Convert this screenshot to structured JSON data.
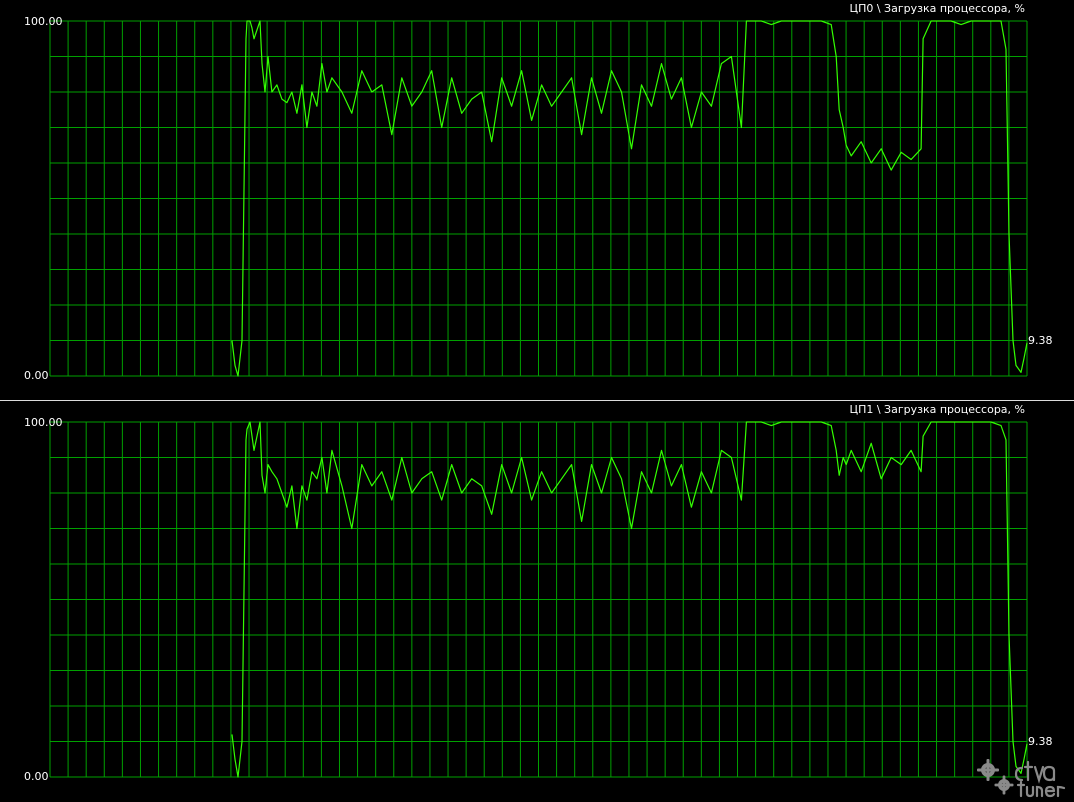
{
  "theme": {
    "background": "#000000",
    "grid_color": "#00a000",
    "line_color": "#33ff00",
    "text_color": "#ffffff",
    "divider_color": "#dcdcdc"
  },
  "chart_data": [
    {
      "type": "line",
      "title": "ЦП0 \\ Загрузка процессора, %",
      "ylim": [
        0,
        100
      ],
      "y_tick_labels": [
        "100.00",
        "0.00"
      ],
      "grid": true,
      "current_value_label": "9.38",
      "x": [
        0,
        3,
        6,
        10,
        14,
        15,
        18,
        20,
        22,
        28,
        30,
        33,
        36,
        40,
        45,
        50,
        55,
        60,
        65,
        70,
        75,
        80,
        85,
        90,
        95,
        100,
        110,
        120,
        130,
        140,
        150,
        160,
        170,
        180,
        190,
        200,
        210,
        220,
        230,
        240,
        250,
        260,
        270,
        280,
        290,
        300,
        310,
        320,
        330,
        340,
        350,
        360,
        370,
        380,
        390,
        400,
        410,
        420,
        430,
        440,
        450,
        460,
        470,
        480,
        490,
        500,
        510,
        515,
        518,
        520,
        525,
        530,
        540,
        550,
        560,
        570,
        580,
        590,
        600,
        605,
        608,
        612,
        615,
        620,
        630,
        640,
        650,
        660,
        670,
        680,
        690,
        692,
        700,
        710,
        720,
        730,
        740,
        750,
        760,
        770,
        775,
        778,
        782,
        785,
        790,
        793,
        796
      ],
      "y": [
        10,
        3,
        0,
        10,
        95,
        100,
        100,
        98,
        95,
        100,
        88,
        80,
        90,
        80,
        82,
        78,
        77,
        80,
        74,
        82,
        70,
        80,
        76,
        88,
        80,
        84,
        80,
        74,
        86,
        80,
        82,
        68,
        84,
        76,
        80,
        86,
        70,
        84,
        74,
        78,
        80,
        66,
        84,
        76,
        86,
        72,
        82,
        76,
        80,
        84,
        68,
        84,
        74,
        86,
        80,
        64,
        82,
        76,
        88,
        78,
        84,
        70,
        80,
        76,
        88,
        90,
        70,
        100,
        100,
        100,
        100,
        100,
        99,
        100,
        100,
        100,
        100,
        100,
        99,
        90,
        75,
        70,
        65,
        62,
        66,
        60,
        64,
        58,
        63,
        61,
        64,
        95,
        100,
        100,
        100,
        99,
        100,
        100,
        100,
        100,
        92,
        40,
        10,
        3,
        1,
        5,
        9.38
      ]
    },
    {
      "type": "line",
      "title": "ЦП1 \\ Загрузка процессора, %",
      "ylim": [
        0,
        100
      ],
      "y_tick_labels": [
        "100.00",
        "0.00"
      ],
      "grid": true,
      "current_value_label": "9.38",
      "x": [
        0,
        3,
        6,
        10,
        14,
        15,
        18,
        20,
        22,
        28,
        30,
        33,
        36,
        40,
        45,
        50,
        55,
        60,
        65,
        70,
        75,
        80,
        85,
        90,
        95,
        100,
        110,
        120,
        130,
        140,
        150,
        160,
        170,
        180,
        190,
        200,
        210,
        220,
        230,
        240,
        250,
        260,
        270,
        280,
        290,
        300,
        310,
        320,
        330,
        340,
        350,
        360,
        370,
        380,
        390,
        400,
        410,
        420,
        430,
        440,
        450,
        460,
        470,
        480,
        490,
        500,
        510,
        515,
        518,
        520,
        525,
        530,
        540,
        550,
        560,
        570,
        580,
        590,
        600,
        605,
        608,
        612,
        615,
        620,
        630,
        640,
        650,
        660,
        670,
        680,
        690,
        692,
        700,
        710,
        720,
        730,
        740,
        750,
        760,
        770,
        775,
        778,
        782,
        785,
        790,
        793,
        796
      ],
      "y": [
        12,
        5,
        0,
        10,
        95,
        98,
        100,
        96,
        92,
        100,
        85,
        80,
        88,
        86,
        84,
        80,
        76,
        82,
        70,
        82,
        78,
        86,
        84,
        90,
        80,
        92,
        82,
        70,
        88,
        82,
        86,
        78,
        90,
        80,
        84,
        86,
        78,
        88,
        80,
        84,
        82,
        74,
        88,
        80,
        90,
        78,
        86,
        80,
        84,
        88,
        72,
        88,
        80,
        90,
        84,
        70,
        86,
        80,
        92,
        82,
        88,
        76,
        86,
        80,
        92,
        90,
        78,
        100,
        100,
        100,
        100,
        100,
        99,
        100,
        100,
        100,
        100,
        100,
        99,
        92,
        85,
        90,
        88,
        92,
        86,
        94,
        84,
        90,
        88,
        92,
        86,
        96,
        100,
        100,
        100,
        100,
        100,
        100,
        100,
        99,
        95,
        40,
        10,
        3,
        1,
        5,
        9.38
      ]
    }
  ],
  "watermark": {
    "text": "ctva tuner"
  }
}
